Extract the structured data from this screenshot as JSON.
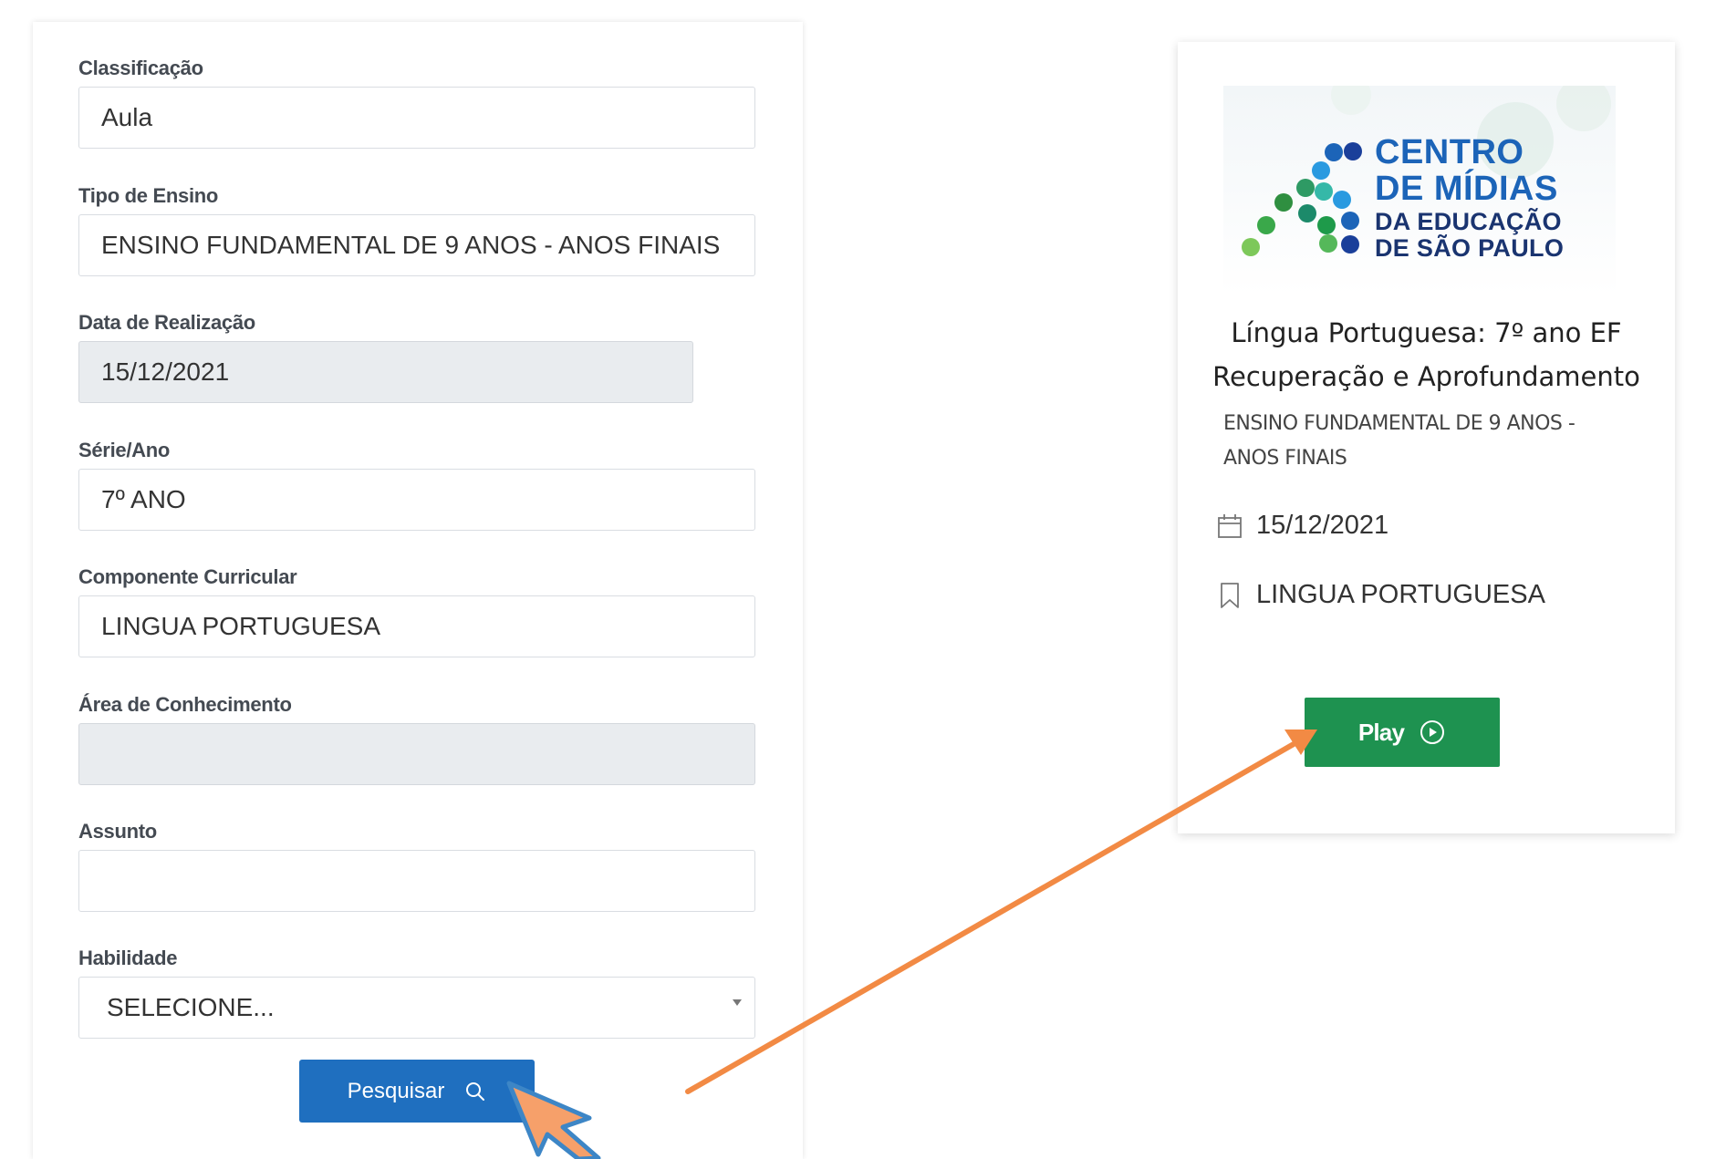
{
  "form": {
    "fields": [
      {
        "label": "Classificação",
        "value": "Aula"
      },
      {
        "label": "Tipo de Ensino",
        "value": "ENSINO FUNDAMENTAL DE 9 ANOS - ANOS FINAIS"
      },
      {
        "label": "Data de Realização",
        "value": "15/12/2021"
      },
      {
        "label": "Série/Ano",
        "value": "7º ANO"
      },
      {
        "label": "Componente Curricular",
        "value": "LINGUA PORTUGUESA"
      },
      {
        "label": "Área de Conhecimento",
        "value": ""
      },
      {
        "label": "Assunto",
        "value": ""
      },
      {
        "label": "Habilidade",
        "value": "SELECIONE..."
      }
    ],
    "search_label": "Pesquisar"
  },
  "result_card": {
    "logo": {
      "line1": "CENTRO",
      "line2": "DE MÍDIAS",
      "line3": "DA EDUCAÇÃO",
      "line4": "DE SÃO PAULO"
    },
    "title_line1": "Língua Portuguesa: 7º ano EF",
    "title_line2": "Recuperação e Aprofundamento",
    "subtitle_line1": "ENSINO FUNDAMENTAL DE 9 ANOS -",
    "subtitle_line2": "ANOS FINAIS",
    "date": "15/12/2021",
    "subject": "LINGUA PORTUGUESA",
    "play_label": "Play"
  },
  "colors": {
    "search_button": "#1f6fbf",
    "play_button": "#1e9250",
    "annotation_arrow": "#f28a44",
    "cursor_outline": "#3d86c6"
  },
  "icons": [
    "search-icon",
    "calendar-icon",
    "bookmark-icon",
    "play-circle-icon",
    "cursor-pointer-icon"
  ]
}
